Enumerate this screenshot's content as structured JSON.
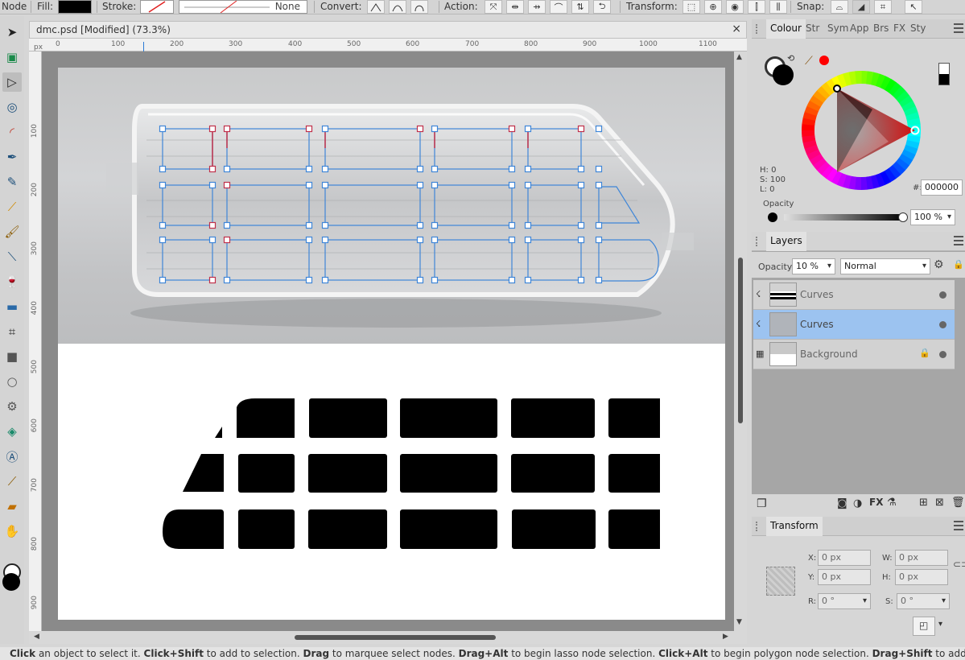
{
  "context_toolbar": {
    "mode": "Node",
    "fill_label": "Fill:",
    "stroke_label": "Stroke:",
    "stroke_style": "None",
    "convert_label": "Convert:",
    "action_label": "Action:",
    "transform_label": "Transform:",
    "snap_label": "Snap:"
  },
  "document": {
    "title": "dmc.psd [Modified] (73.3%)",
    "close": "×",
    "ruler_top": [
      "px",
      "0",
      "100",
      "200",
      "300",
      "400",
      "500",
      "600",
      "700",
      "800",
      "900",
      "1000",
      "1100"
    ],
    "ruler_left": [
      "100",
      "200",
      "300",
      "400",
      "500",
      "600",
      "700",
      "800",
      "900"
    ]
  },
  "colour_panel": {
    "tabs": [
      "Colour",
      "Str",
      "Sym",
      "App",
      "Brs",
      "FX",
      "Sty"
    ],
    "h": "H: 0",
    "s": "S: 100",
    "l": "L: 0",
    "hex_label": "#:",
    "hex": "000000",
    "opacity_label": "Opacity",
    "opacity": "100 %",
    "fill_color": "#000000",
    "accent_color": "#ff0000"
  },
  "layers_panel": {
    "title": "Layers",
    "opacity_label": "Opacity:",
    "opacity": "10 %",
    "blend_mode": "Normal",
    "layers": [
      {
        "name": "Curves",
        "selected": false
      },
      {
        "name": "Curves",
        "selected": true
      },
      {
        "name": "Background",
        "selected": false,
        "locked": true
      }
    ]
  },
  "transform_panel": {
    "title": "Transform",
    "x_label": "X:",
    "x": "0 px",
    "y_label": "Y:",
    "y": "0 px",
    "w_label": "W:",
    "w": "0 px",
    "h_label": "H:",
    "h": "0 px",
    "r_label": "R:",
    "r": "0 °",
    "s_label": "S:",
    "s": "0 °"
  },
  "status_bar": {
    "parts": [
      {
        "t": "Click",
        "b": true
      },
      {
        "t": " an object to select it. ",
        "b": false
      },
      {
        "t": "Click+Shift",
        "b": true
      },
      {
        "t": " to add to selection. ",
        "b": false
      },
      {
        "t": "Drag",
        "b": true
      },
      {
        "t": " to marquee select nodes. ",
        "b": false
      },
      {
        "t": "Drag+Alt",
        "b": true
      },
      {
        "t": " to begin lasso node selection. ",
        "b": false
      },
      {
        "t": "Click+Alt",
        "b": true
      },
      {
        "t": " to begin polygon node selection. ",
        "b": false
      },
      {
        "t": "Drag+Shift",
        "b": true
      },
      {
        "t": " to add nodes to selectio",
        "b": false
      }
    ]
  }
}
